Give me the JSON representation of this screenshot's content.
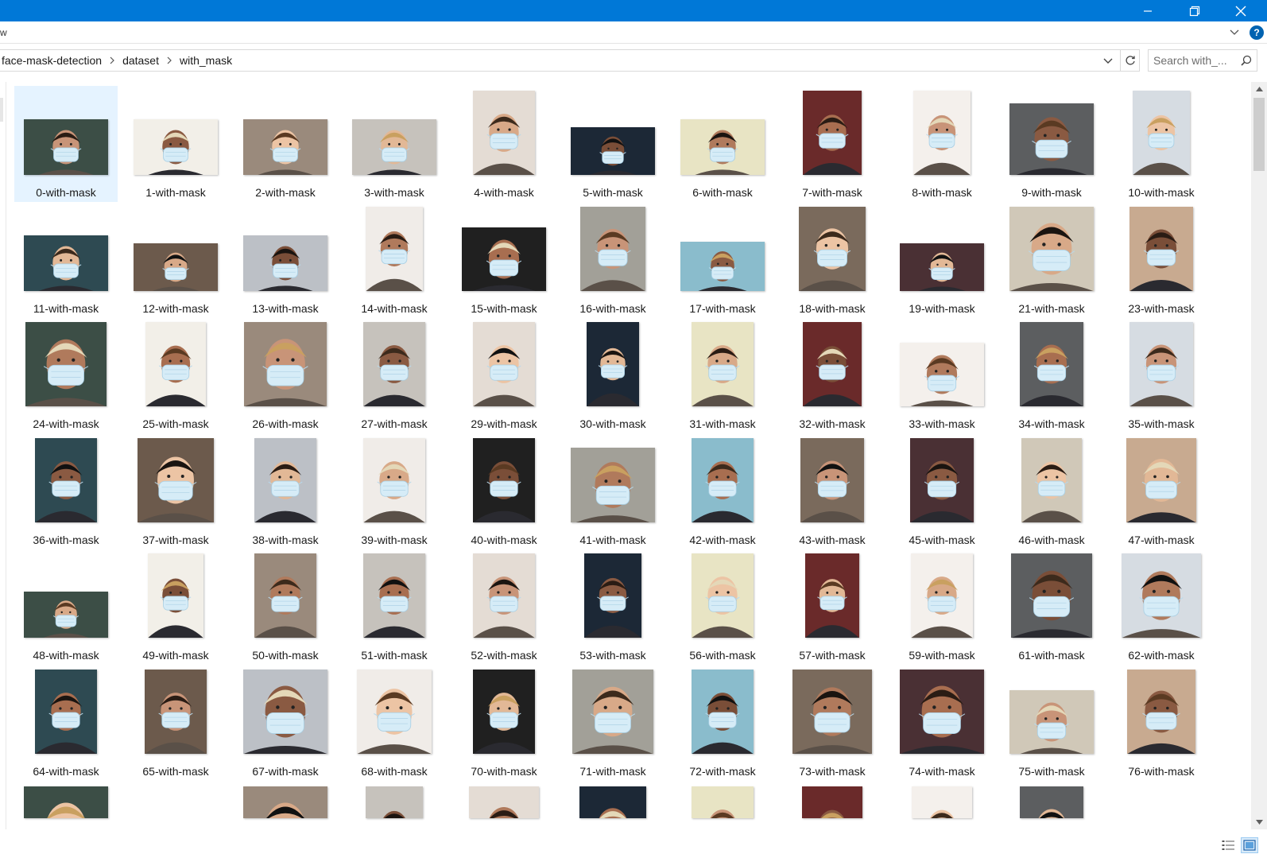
{
  "titlebar": {
    "minimize_icon": "minimize-icon",
    "maximize_icon": "restore-icon",
    "close_icon": "close-icon",
    "color": "#0078d7"
  },
  "ribbon": {
    "left_fragment": "w",
    "help_label": "?"
  },
  "address": {
    "crumbs": [
      "face-mask-detection",
      "dataset",
      "with_mask"
    ]
  },
  "search": {
    "placeholder": "Search with_..."
  },
  "files": [
    "0-with-mask",
    "1-with-mask",
    "2-with-mask",
    "3-with-mask",
    "4-with-mask",
    "5-with-mask",
    "6-with-mask",
    "7-with-mask",
    "8-with-mask",
    "9-with-mask",
    "10-with-mask",
    "11-with-mask",
    "12-with-mask",
    "13-with-mask",
    "14-with-mask",
    "15-with-mask",
    "16-with-mask",
    "17-with-mask",
    "18-with-mask",
    "19-with-mask",
    "21-with-mask",
    "23-with-mask",
    "24-with-mask",
    "25-with-mask",
    "26-with-mask",
    "27-with-mask",
    "29-with-mask",
    "30-with-mask",
    "31-with-mask",
    "32-with-mask",
    "33-with-mask",
    "34-with-mask",
    "35-with-mask",
    "36-with-mask",
    "37-with-mask",
    "38-with-mask",
    "39-with-mask",
    "40-with-mask",
    "41-with-mask",
    "42-with-mask",
    "43-with-mask",
    "45-with-mask",
    "46-with-mask",
    "47-with-mask",
    "48-with-mask",
    "49-with-mask",
    "50-with-mask",
    "51-with-mask",
    "52-with-mask",
    "53-with-mask",
    "56-with-mask",
    "57-with-mask",
    "59-with-mask",
    "61-with-mask",
    "62-with-mask",
    "64-with-mask",
    "65-with-mask",
    "67-with-mask",
    "68-with-mask",
    "70-with-mask",
    "71-with-mask",
    "72-with-mask",
    "73-with-mask",
    "74-with-mask",
    "75-with-mask",
    "76-with-mask"
  ],
  "selected_file": "0-with-mask",
  "colors": {
    "accent": "#0078d7",
    "selection": "#e5f3ff",
    "mask": "#d6ecf7"
  }
}
